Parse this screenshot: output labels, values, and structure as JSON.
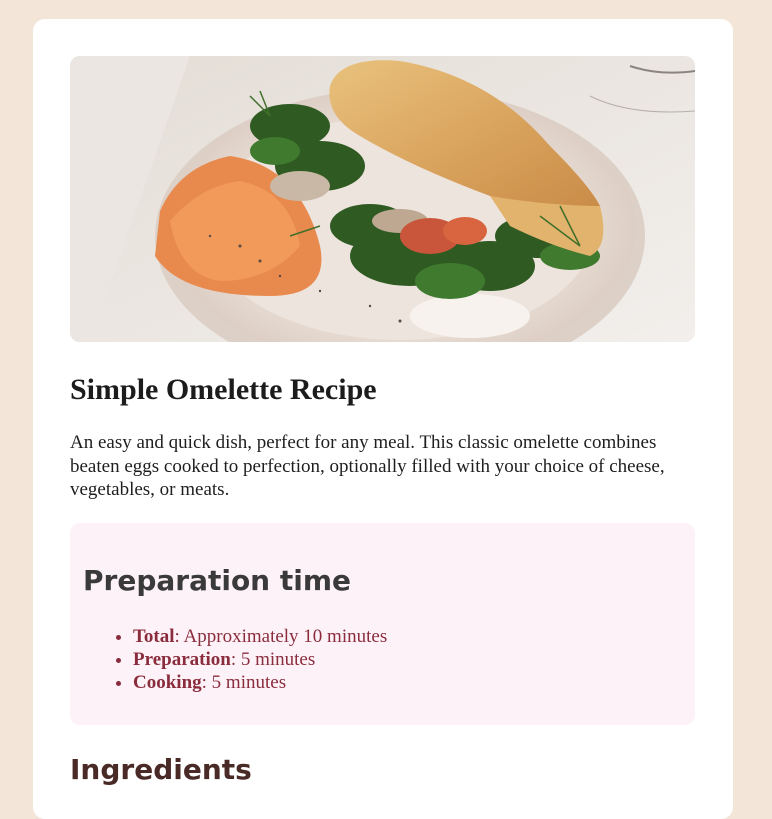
{
  "recipe": {
    "title": "Simple Omelette Recipe",
    "description": "An easy and quick dish, perfect for any meal. This classic omelette combines beaten eggs cooked to perfection, optionally filled with your choice of cheese, vegetables, or meats.",
    "image_alt": "omelette on a plate with spinach and hummus"
  },
  "preparation": {
    "heading": "Preparation time",
    "items": [
      {
        "label": "Total",
        "value": ": Approximately 10 minutes"
      },
      {
        "label": "Preparation",
        "value": ": 5 minutes"
      },
      {
        "label": "Cooking",
        "value": ": 5 minutes"
      }
    ]
  },
  "ingredients": {
    "heading": "Ingredients"
  },
  "colors": {
    "page_background": "#f3e5d8",
    "card_background": "#ffffff",
    "prep_background": "#fdf2f8",
    "prep_accent": "#8a2c3c"
  }
}
